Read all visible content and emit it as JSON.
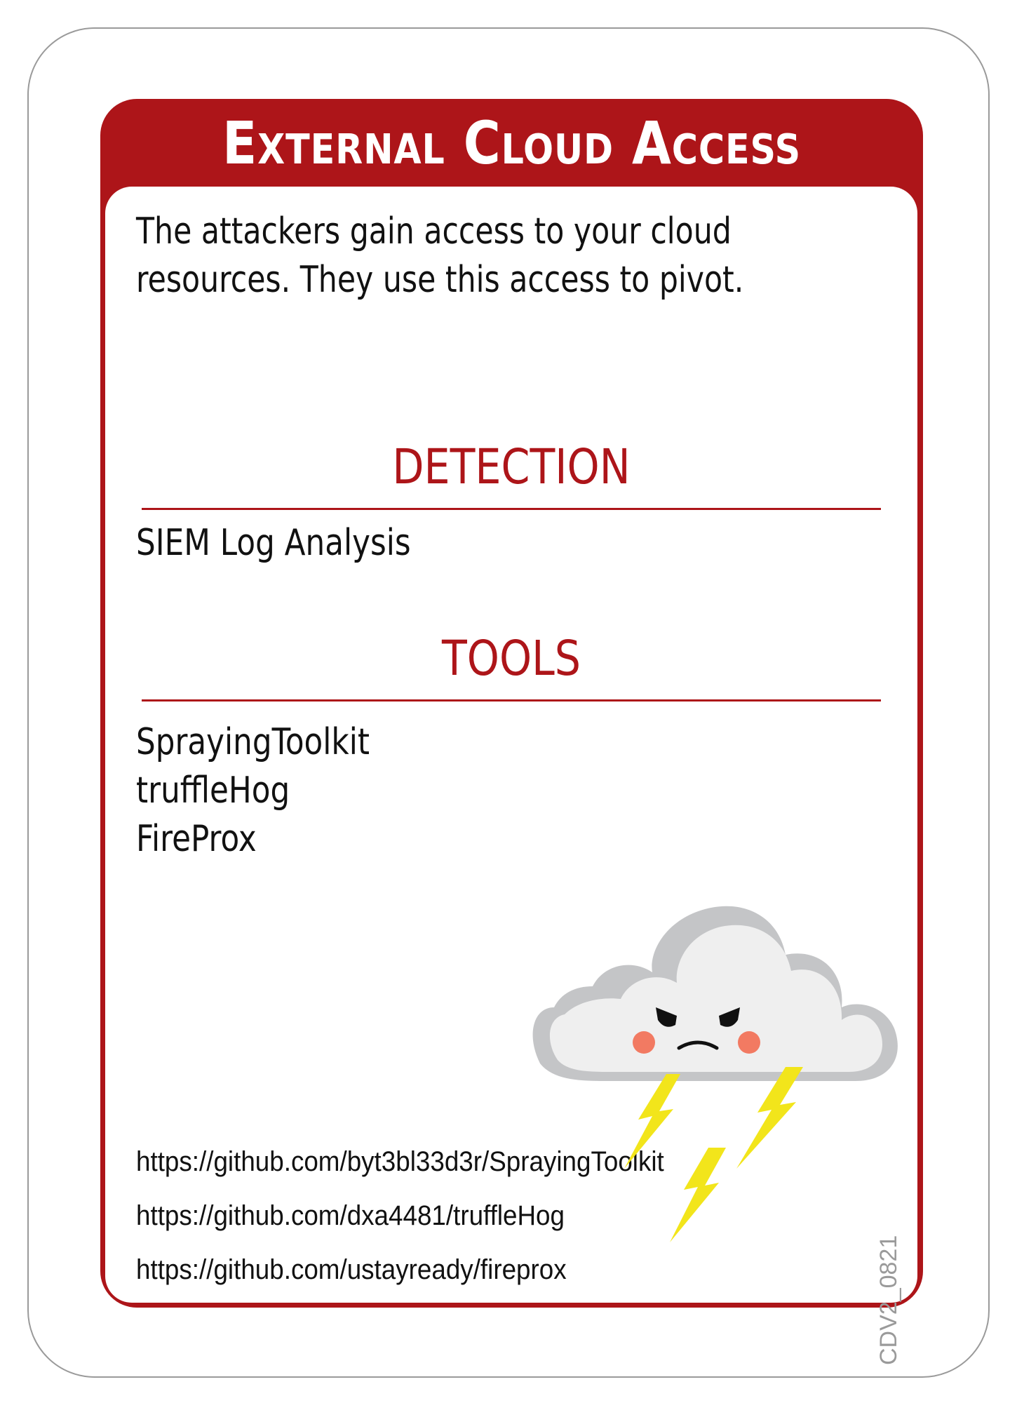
{
  "card": {
    "title": "External Cloud Access",
    "description_lines": [
      "The attackers gain access to your cloud",
      "resources. They use this access to pivot."
    ],
    "detection": {
      "heading": "DETECTION",
      "items": [
        "SIEM Log Analysis"
      ]
    },
    "tools": {
      "heading": "TOOLS",
      "items": [
        "SprayingToolkit",
        "truffleHog",
        "FireProx"
      ]
    },
    "links": [
      "https://github.com/byt3bl33d3r/SprayingToolkit",
      "https://github.com/dxa4481/truffleHog",
      "https://github.com/ustayready/fireprox"
    ],
    "card_code": "CDV2_0821",
    "illustration": "angry-storm-cloud-icon",
    "colors": {
      "accent": "#ad1519",
      "cloud": "#efefef",
      "cloud_shadow": "#c4c5c7",
      "lightning": "#f2e51b",
      "cheek": "#f27a62"
    }
  }
}
